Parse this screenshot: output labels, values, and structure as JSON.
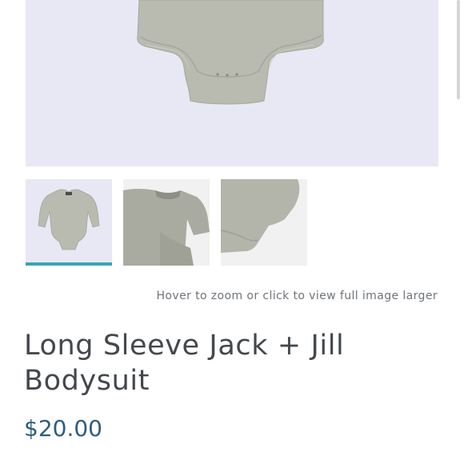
{
  "product": {
    "title": "Long Sleeve Jack + Jill Bodysuit",
    "price": "$20.00"
  },
  "gallery": {
    "hint": "Hover to zoom or click to view full image larger",
    "active_thumbnail": 1,
    "thumbnails": [
      {
        "view": "front-full"
      },
      {
        "view": "sleeve-detail"
      },
      {
        "view": "snap-closure-detail"
      }
    ]
  },
  "colors": {
    "accent": "#3aa3b6",
    "price": "#2f5d7c",
    "garment": "#b9bab0",
    "image_background": "#e7e8f3"
  }
}
